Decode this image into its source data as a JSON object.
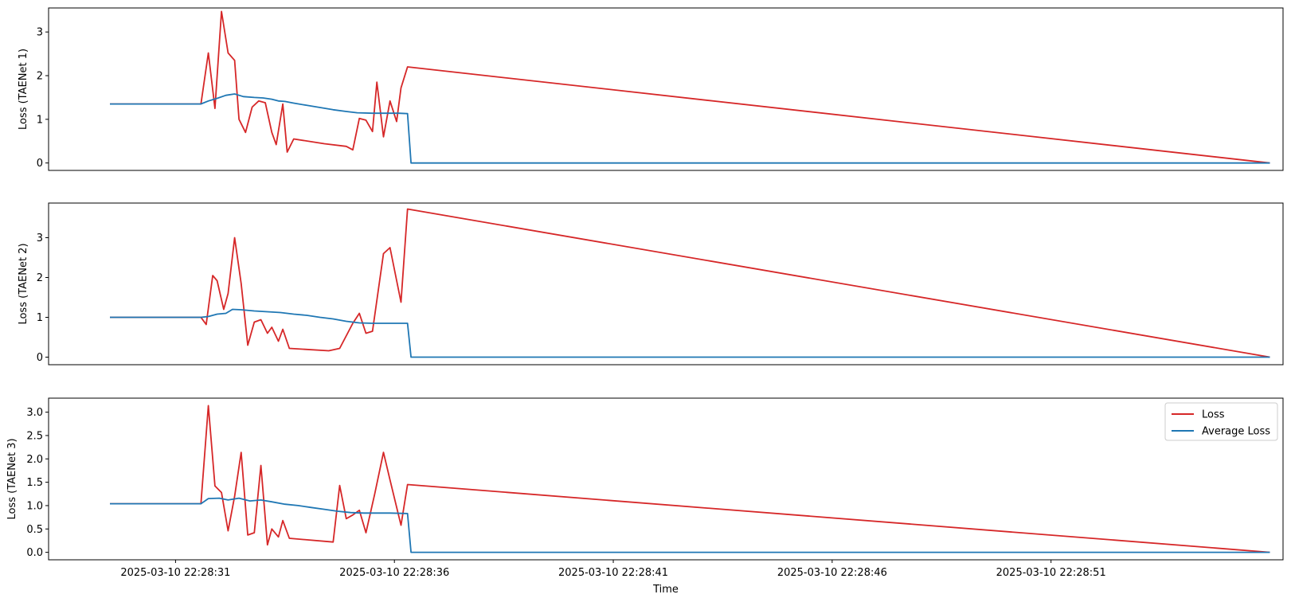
{
  "chart_data": {
    "type": "line",
    "xlabel": "Time",
    "x_tick_labels": [
      "2025-03-10 22:28:31",
      "2025-03-10 22:28:36",
      "2025-03-10 22:28:41",
      "2025-03-10 22:28:46",
      "2025-03-10 22:28:51"
    ],
    "x_tick_seconds": [
      31,
      36,
      41,
      46,
      51
    ],
    "xlim_seconds": [
      28.1,
      56.3
    ],
    "grid": false,
    "legend": {
      "placement": "upper right",
      "panel": 3,
      "entries": [
        "Loss",
        "Average Loss"
      ]
    },
    "colors": {
      "loss": "#d62728",
      "average_loss": "#1f77b4"
    },
    "panels": [
      {
        "ylabel": "Loss (TAENet 1)",
        "ylim": [
          -0.17,
          3.55
        ],
        "yticks": [
          0,
          1,
          2,
          3
        ],
        "ytick_labels": [
          "0",
          "1",
          "2",
          "3"
        ],
        "series": [
          {
            "name": "Loss",
            "x": [
              29.5,
              31.58,
              31.75,
              31.9,
              32.05,
              32.2,
              32.35,
              32.45,
              32.6,
              32.75,
              32.9,
              33.05,
              33.2,
              33.3,
              33.45,
              33.55,
              33.7,
              34.4,
              34.9,
              35.05,
              35.2,
              35.35,
              35.5,
              35.6,
              35.75,
              35.9,
              36.05,
              36.15,
              36.3,
              56.0
            ],
            "y": [
              1.35,
              1.35,
              2.52,
              1.25,
              3.47,
              2.52,
              2.35,
              1.0,
              0.7,
              1.28,
              1.42,
              1.38,
              0.7,
              0.42,
              1.35,
              0.25,
              0.55,
              0.44,
              0.38,
              0.3,
              1.02,
              0.98,
              0.72,
              1.85,
              0.6,
              1.42,
              0.95,
              1.72,
              2.2,
              0.0
            ]
          },
          {
            "name": "Average Loss",
            "x": [
              29.5,
              31.58,
              31.75,
              31.95,
              32.15,
              32.35,
              32.55,
              32.8,
              33.0,
              33.2,
              33.35,
              33.5,
              33.7,
              34.0,
              34.3,
              34.6,
              34.9,
              35.15,
              35.5,
              35.8,
              36.1,
              36.3,
              36.38,
              56.0
            ],
            "y": [
              1.35,
              1.35,
              1.42,
              1.48,
              1.55,
              1.58,
              1.52,
              1.5,
              1.49,
              1.46,
              1.42,
              1.41,
              1.37,
              1.32,
              1.27,
              1.22,
              1.18,
              1.15,
              1.14,
              1.14,
              1.14,
              1.13,
              0.0,
              0.0
            ]
          }
        ]
      },
      {
        "ylabel": "Loss (TAENet 2)",
        "ylim": [
          -0.19,
          3.87
        ],
        "yticks": [
          0,
          1,
          2,
          3
        ],
        "ytick_labels": [
          "0",
          "1",
          "2",
          "3"
        ],
        "series": [
          {
            "name": "Loss",
            "x": [
              29.5,
              31.58,
              31.7,
              31.85,
              31.95,
              32.1,
              32.2,
              32.35,
              32.5,
              32.65,
              32.8,
              32.95,
              33.1,
              33.2,
              33.35,
              33.45,
              33.6,
              34.5,
              34.75,
              35.05,
              35.2,
              35.35,
              35.5,
              35.75,
              35.9,
              36.15,
              36.3,
              56.0
            ],
            "y": [
              1.0,
              1.0,
              0.82,
              2.05,
              1.92,
              1.2,
              1.6,
              3.0,
              1.85,
              0.3,
              0.88,
              0.94,
              0.6,
              0.75,
              0.4,
              0.7,
              0.22,
              0.16,
              0.22,
              0.85,
              1.1,
              0.6,
              0.65,
              2.6,
              2.75,
              1.38,
              3.72,
              0.0
            ]
          },
          {
            "name": "Average Loss",
            "x": [
              29.5,
              31.58,
              31.75,
              31.95,
              32.15,
              32.3,
              32.5,
              32.8,
              33.1,
              33.4,
              33.7,
              34.0,
              34.3,
              34.6,
              34.9,
              35.2,
              35.5,
              35.8,
              36.1,
              36.3,
              36.38,
              56.0
            ],
            "y": [
              1.0,
              1.0,
              1.02,
              1.08,
              1.1,
              1.2,
              1.19,
              1.16,
              1.14,
              1.12,
              1.08,
              1.05,
              1.0,
              0.96,
              0.9,
              0.86,
              0.85,
              0.85,
              0.85,
              0.85,
              0.0,
              0.0
            ]
          }
        ]
      },
      {
        "ylabel": "Loss (TAENet 3)",
        "ylim": [
          -0.16,
          3.3
        ],
        "yticks": [
          0.0,
          0.5,
          1.0,
          1.5,
          2.0,
          2.5,
          3.0
        ],
        "ytick_labels": [
          "0.0",
          "0.5",
          "1.0",
          "1.5",
          "2.0",
          "2.5",
          "3.0"
        ],
        "series": [
          {
            "name": "Loss",
            "x": [
              29.5,
              31.58,
              31.75,
              31.9,
              32.05,
              32.2,
              32.35,
              32.5,
              32.65,
              32.8,
              32.95,
              33.1,
              33.2,
              33.35,
              33.45,
              33.6,
              34.6,
              34.75,
              34.9,
              35.05,
              35.2,
              35.35,
              35.55,
              35.75,
              35.9,
              36.15,
              36.3,
              56.0
            ],
            "y": [
              1.04,
              1.04,
              3.14,
              1.42,
              1.28,
              0.46,
              1.2,
              2.14,
              0.37,
              0.42,
              1.86,
              0.16,
              0.5,
              0.33,
              0.68,
              0.3,
              0.22,
              1.43,
              0.72,
              0.8,
              0.9,
              0.42,
              1.25,
              2.14,
              1.55,
              0.58,
              1.45,
              0.0
            ]
          },
          {
            "name": "Average Loss",
            "x": [
              29.5,
              31.58,
              31.75,
              32.0,
              32.2,
              32.45,
              32.7,
              32.95,
              33.2,
              33.5,
              33.8,
              34.1,
              34.4,
              34.7,
              35.0,
              35.3,
              35.6,
              35.9,
              36.3,
              36.38,
              56.0
            ],
            "y": [
              1.04,
              1.04,
              1.15,
              1.16,
              1.12,
              1.16,
              1.1,
              1.12,
              1.08,
              1.03,
              1.0,
              0.96,
              0.92,
              0.88,
              0.85,
              0.84,
              0.84,
              0.84,
              0.83,
              0.0,
              0.0
            ]
          }
        ]
      }
    ]
  }
}
